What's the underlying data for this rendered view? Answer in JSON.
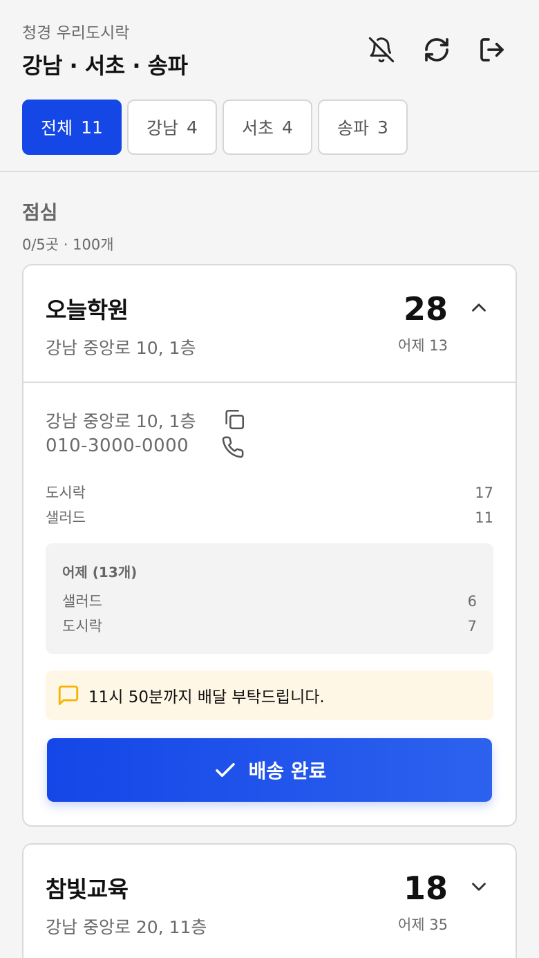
{
  "header": {
    "brand": "청경 우리도시락",
    "region_title": "강남 · 서초 · 송파",
    "icons": [
      "bell-off-icon",
      "refresh-icon",
      "logout-icon"
    ]
  },
  "tabs": [
    {
      "label": "전체",
      "count": "11",
      "active": true
    },
    {
      "label": "강남",
      "count": "4",
      "active": false
    },
    {
      "label": "서초",
      "count": "4",
      "active": false
    },
    {
      "label": "송파",
      "count": "3",
      "active": false
    }
  ],
  "section": {
    "title": "점심",
    "summary": "0/5곳 · 100개"
  },
  "cards": [
    {
      "name": "오늘학원",
      "address": "강남 중앙로 10, 1층",
      "count": "28",
      "yesterday": "어제 13",
      "expanded": true,
      "detail_address": "강남 중앙로 10, 1층",
      "phone": "010-3000-0000",
      "items": [
        {
          "name": "도시락",
          "qty": "17"
        },
        {
          "name": "샐러드",
          "qty": "11"
        }
      ],
      "yesterday_box": {
        "title": "어제 (13개)",
        "items": [
          {
            "name": "샐러드",
            "qty": "6"
          },
          {
            "name": "도시락",
            "qty": "7"
          }
        ]
      },
      "note": "11시 50분까지 배달 부탁드립니다.",
      "done_label": "배송 완료"
    },
    {
      "name": "참빛교육",
      "address": "강남 중앙로 20, 11층",
      "count": "18",
      "yesterday": "어제 35",
      "expanded": false
    }
  ],
  "colors": {
    "accent": "#1447e6",
    "note_bg": "#fff7e6",
    "note_icon": "#f5b400",
    "muted_text": "#6a6a6a"
  }
}
